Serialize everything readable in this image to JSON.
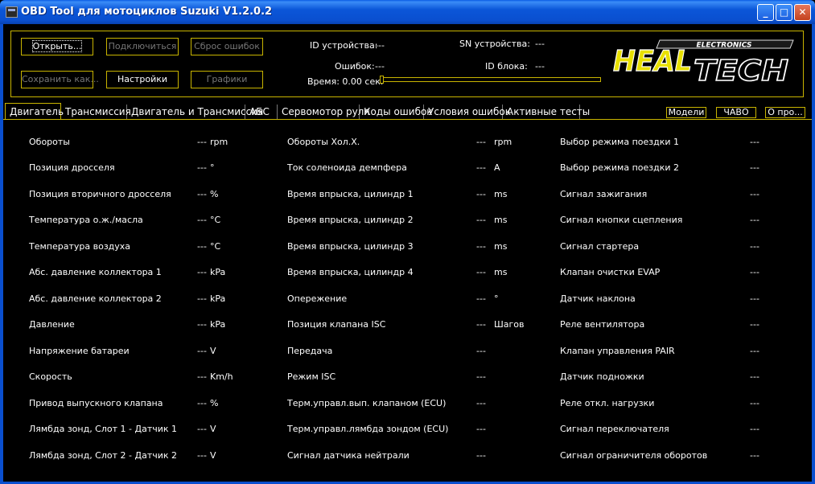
{
  "window": {
    "title": "OBD Tool для мотоциклов Suzuki V1.2.0.2",
    "minimize": "_",
    "maximize": "□",
    "close": "✕"
  },
  "toolbar": {
    "open": "Открыть...",
    "connect": "Подключиться",
    "reset_errors": "Сброс ошибок",
    "save_as": "Сохранить как...",
    "settings": "Настройки",
    "graphs": "Графики"
  },
  "device": {
    "id_label": "ID устройства:",
    "id_value": "---",
    "sn_label": "SN устройства:",
    "sn_value": "---",
    "errors_label": "Ошибок:",
    "errors_value": "---",
    "block_label": "ID блока:",
    "block_value": "---",
    "time_label": "Время: 0.00 сек.",
    "time_progress": 0
  },
  "logo": {
    "brand_top": "ELECTRONICS",
    "brand_heal": "HEAL",
    "brand_tech": "TECH"
  },
  "tabs": [
    "Двигатель",
    "Трансмиссия",
    "Двигатель и Трансмиссия",
    "АБС",
    "Сервомотор руля",
    "Коды ошибок",
    "Условия ошибок",
    "Активные тесты"
  ],
  "side_buttons": {
    "models": "Модели",
    "faq": "ЧАВО",
    "about": "О про..."
  },
  "col1": [
    {
      "label": "Обороты",
      "value": "---",
      "unit": "rpm"
    },
    {
      "label": "Позиция дросселя",
      "value": "---",
      "unit": "°"
    },
    {
      "label": "Позиция вторичного дросселя",
      "value": "---",
      "unit": "%"
    },
    {
      "label": "Температура о.ж./масла",
      "value": "---",
      "unit": "°C"
    },
    {
      "label": "Температура воздуха",
      "value": "---",
      "unit": "°C"
    },
    {
      "label": "Абс. давление коллектора 1",
      "value": "---",
      "unit": "kPa"
    },
    {
      "label": "Абс. давление коллектора 2",
      "value": "---",
      "unit": "kPa"
    },
    {
      "label": "Давление",
      "value": "---",
      "unit": "kPa"
    },
    {
      "label": "Напряжение батареи",
      "value": "---",
      "unit": "V"
    },
    {
      "label": "Скорость",
      "value": "---",
      "unit": "Km/h"
    },
    {
      "label": "Привод выпускного клапана",
      "value": "---",
      "unit": "%"
    },
    {
      "label": "Лямбда зонд, Слот 1 - Датчик 1",
      "value": "---",
      "unit": "V"
    },
    {
      "label": "Лямбда зонд, Слот 2 - Датчик 2",
      "value": "---",
      "unit": "V"
    }
  ],
  "col2": [
    {
      "label": "Обороты Хол.Х.",
      "value": "---",
      "unit": "rpm"
    },
    {
      "label": "Ток соленоида демпфера",
      "value": "---",
      "unit": "A"
    },
    {
      "label": "Время впрыска, цилиндр 1",
      "value": "---",
      "unit": "ms"
    },
    {
      "label": "Время впрыска, цилиндр 2",
      "value": "---",
      "unit": "ms"
    },
    {
      "label": "Время впрыска, цилиндр 3",
      "value": "---",
      "unit": "ms"
    },
    {
      "label": "Время впрыска, цилиндр 4",
      "value": "---",
      "unit": "ms"
    },
    {
      "label": "Опережение",
      "value": "---",
      "unit": "°"
    },
    {
      "label": "Позиция клапана ISC",
      "value": "---",
      "unit": "Шагов"
    },
    {
      "label": "Передача",
      "value": "---",
      "unit": ""
    },
    {
      "label": "Режим ISC",
      "value": "---",
      "unit": ""
    },
    {
      "label": "Терм.управл.вып. клапаном (ECU)",
      "value": "---",
      "unit": ""
    },
    {
      "label": "Терм.управл.лямбда зондом (ECU)",
      "value": "---",
      "unit": ""
    },
    {
      "label": "Сигнал датчика нейтрали",
      "value": "---",
      "unit": ""
    }
  ],
  "col3": [
    {
      "label": "Выбор режима поездки 1",
      "value": "---"
    },
    {
      "label": "Выбор режима поездки 2",
      "value": "---"
    },
    {
      "label": "Сигнал зажигания",
      "value": "---"
    },
    {
      "label": "Сигнал кнопки сцепления",
      "value": "---"
    },
    {
      "label": "Сигнал стартера",
      "value": "---"
    },
    {
      "label": "Клапан очистки EVAP",
      "value": "---"
    },
    {
      "label": "Датчик наклона",
      "value": "---"
    },
    {
      "label": "Реле вентилятора",
      "value": "---"
    },
    {
      "label": "Клапан управления PAIR",
      "value": "---"
    },
    {
      "label": "Датчик подножки",
      "value": "---"
    },
    {
      "label": "Реле откл. нагрузки",
      "value": "---"
    },
    {
      "label": "Сигнал переключателя",
      "value": "---"
    },
    {
      "label": "Сигнал ограничителя оборотов",
      "value": "---"
    }
  ]
}
